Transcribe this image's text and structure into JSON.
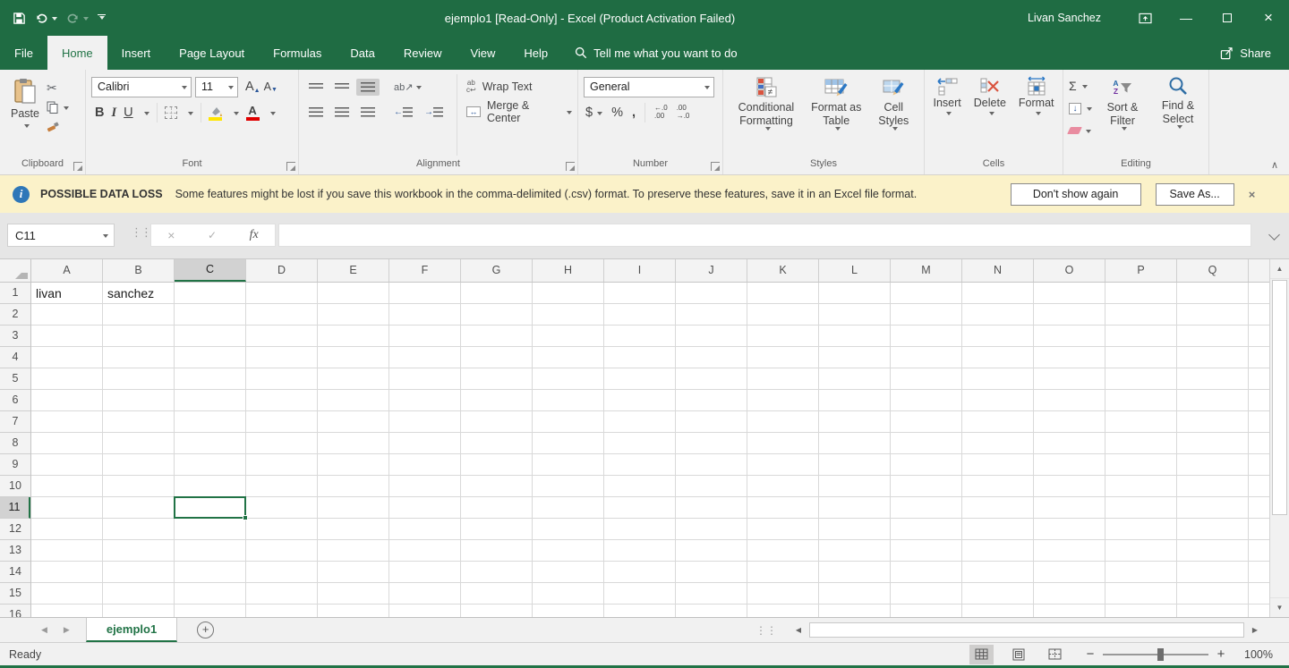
{
  "titlebar": {
    "title": "ejemplo1  [Read-Only]  -  Excel (Product Activation Failed)",
    "user": "Livan Sanchez"
  },
  "tabs": [
    {
      "label": "File",
      "active": false
    },
    {
      "label": "Home",
      "active": true
    },
    {
      "label": "Insert",
      "active": false
    },
    {
      "label": "Page Layout",
      "active": false
    },
    {
      "label": "Formulas",
      "active": false
    },
    {
      "label": "Data",
      "active": false
    },
    {
      "label": "Review",
      "active": false
    },
    {
      "label": "View",
      "active": false
    },
    {
      "label": "Help",
      "active": false
    }
  ],
  "tellme": "Tell me what you want to do",
  "share": "Share",
  "ribbon": {
    "clipboard": {
      "label": "Clipboard",
      "paste": "Paste"
    },
    "font": {
      "label": "Font",
      "font_name": "Calibri",
      "font_size": "11",
      "bold": "B",
      "italic": "I",
      "underline": "U"
    },
    "alignment": {
      "label": "Alignment",
      "wrap_text": "Wrap Text",
      "merge_center": "Merge & Center"
    },
    "number": {
      "label": "Number",
      "format": "General",
      "currency": "$",
      "percent": "%",
      "comma": ","
    },
    "styles": {
      "label": "Styles",
      "conditional": "Conditional Formatting",
      "format_table": "Format as Table",
      "cell_styles": "Cell Styles"
    },
    "cells": {
      "label": "Cells",
      "insert": "Insert",
      "delete": "Delete",
      "format": "Format"
    },
    "editing": {
      "label": "Editing",
      "autosum": "Σ",
      "sort_filter": "Sort & Filter",
      "find_select": "Find & Select"
    }
  },
  "message_bar": {
    "title": "POSSIBLE DATA LOSS",
    "text": "Some features might be lost if you save this workbook in the comma-delimited (.csv) format. To preserve these features, save it in an Excel file format.",
    "dont_show_label": "Don't show again",
    "save_as_label": "Save As..."
  },
  "formula_bar": {
    "name_box": "C11",
    "fx": "fx",
    "value": ""
  },
  "grid": {
    "columns": [
      "A",
      "B",
      "C",
      "D",
      "E",
      "F",
      "G",
      "H",
      "I",
      "J",
      "K",
      "L",
      "M",
      "N",
      "O",
      "P",
      "Q"
    ],
    "row_count": 16,
    "selected": "C11",
    "cells": {
      "A1": "livan",
      "B1": "sanchez"
    }
  },
  "sheet_tabs": {
    "active": "ejemplo1"
  },
  "status_bar": {
    "ready": "Ready",
    "zoom": "100%"
  },
  "colors": {
    "accent_green": "#217346",
    "titlebar_green": "#1f6c43",
    "message_bar_bg": "#fbf2c9",
    "fill_color_swatch": "#ffe500",
    "font_color_swatch": "#e00000",
    "selection_border": "#217346"
  }
}
